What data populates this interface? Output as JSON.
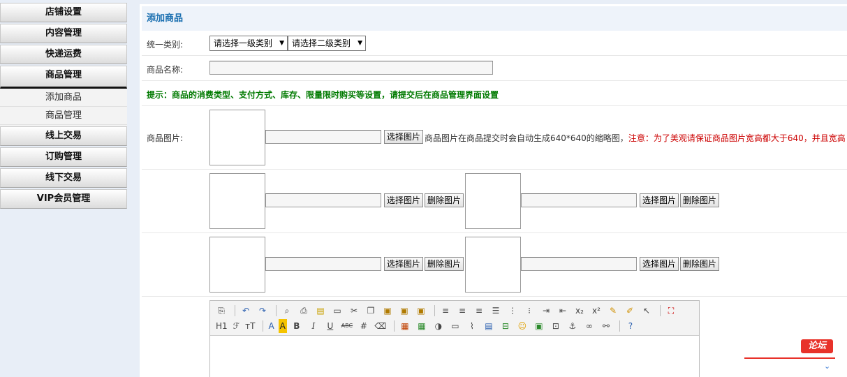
{
  "sidebar": {
    "items": [
      {
        "label": "店铺设置"
      },
      {
        "label": "内容管理"
      },
      {
        "label": "快递运费"
      },
      {
        "label": "商品管理"
      },
      {
        "label": "线上交易"
      },
      {
        "label": "订购管理"
      },
      {
        "label": "线下交易"
      },
      {
        "label": "VIP会员管理"
      }
    ],
    "submenu": [
      {
        "label": "添加商品"
      },
      {
        "label": "商品管理"
      }
    ]
  },
  "main": {
    "title": "添加商品",
    "category": {
      "label": "统一类别:",
      "level1": "请选择一级类别",
      "level2": "请选择二级类别"
    },
    "name": {
      "label": "商品名称:",
      "value": ""
    },
    "hint": "提示：商品的消费类型、支付方式、库存、限量限时购买等设置，请提交后在商品管理界面设置",
    "image": {
      "label": "商品图片:",
      "choose_label": "选择图片",
      "delete_label": "删除图片",
      "note": "商品图片在商品提交时会自动生成640*640的缩略图，",
      "warning": "注意：为了美观请保证商品图片宽高都大于640，并且宽高"
    }
  },
  "editor": {
    "toolbar_row1": [
      "source-icon",
      "undo-icon",
      "redo-icon",
      "preview-icon",
      "print-icon",
      "template-icon",
      "code-icon",
      "cut-icon",
      "copy-icon",
      "paste-icon",
      "paste-text-icon",
      "paste-word-icon",
      "align-left-icon",
      "align-center-icon",
      "align-right-icon",
      "justify-icon",
      "ordered-list-icon",
      "unordered-list-icon",
      "indent-icon",
      "outdent-icon",
      "subscript-icon",
      "superscript-icon",
      "clear-format-icon",
      "select-all-icon",
      "cursor-icon",
      "fullscreen-icon"
    ],
    "toolbar_row2_text": {
      "heading": "H1",
      "font": "ℱ",
      "size": "тT",
      "color": "A",
      "highlight": "A",
      "bold": "B",
      "italic": "I",
      "underline": "U",
      "strike": "ABC"
    }
  },
  "float_widget": {
    "label": "论坛"
  }
}
